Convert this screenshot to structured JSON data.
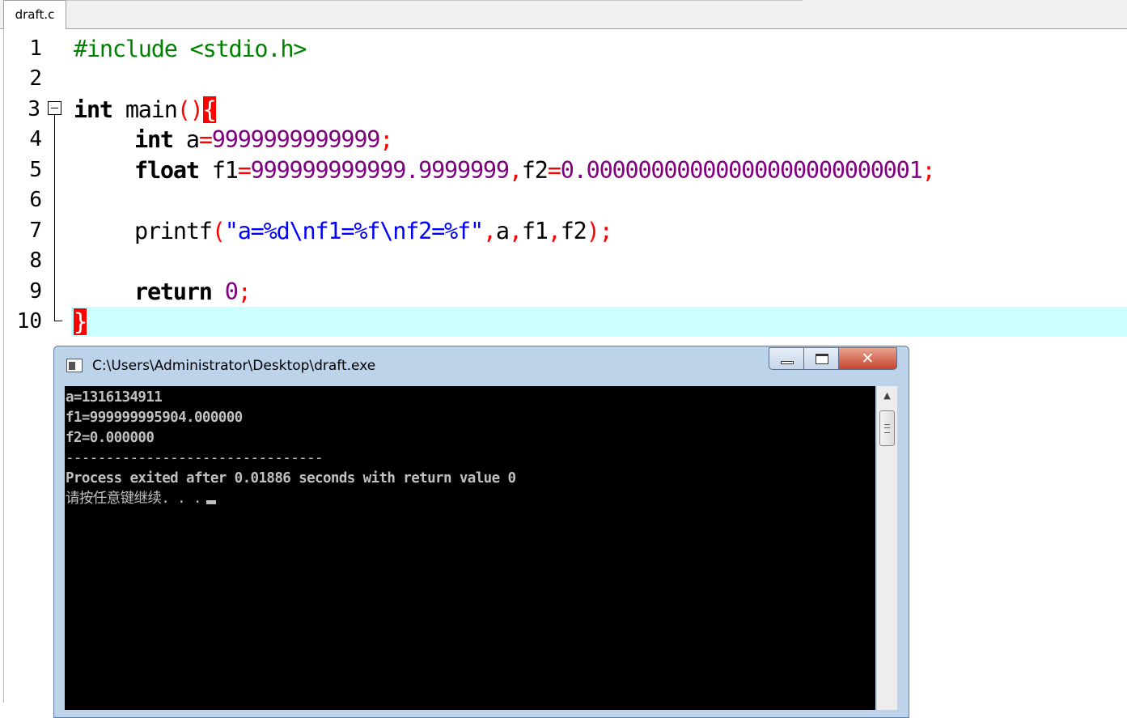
{
  "tab": {
    "label": "draft.c"
  },
  "editor": {
    "line_numbers": [
      "1",
      "2",
      "3",
      "4",
      "5",
      "6",
      "7",
      "8",
      "9",
      "10"
    ],
    "lines": {
      "l1_directive": "#include <stdio.h>",
      "l3_type": "int",
      "l3_func": " main",
      "l3_parens": "()",
      "l3_brace": "{",
      "l4_type": "int",
      "l4_var": " a",
      "l4_eq": "=",
      "l4_val": "9999999999999",
      "l4_semi": ";",
      "l5_type": "float",
      "l5_var1": " f1",
      "l5_eq1": "=",
      "l5_val1": "999999999999.9999999",
      "l5_comma": ",",
      "l5_var2": "f2",
      "l5_eq2": "=",
      "l5_val2": "0.00000000000000000000000001",
      "l5_semi": ";",
      "l7_func": "printf",
      "l7_open": "(",
      "l7_str": "\"a=%d\\nf1=%f\\nf2=%f\"",
      "l7_c1": ",",
      "l7_a": "a",
      "l7_c2": ",",
      "l7_f1": "f1",
      "l7_c3": ",",
      "l7_f2": "f2",
      "l7_close": ");",
      "l9_kw": "return",
      "l9_val": "0",
      "l9_semi": ";",
      "l10_brace": "}"
    }
  },
  "console": {
    "title": "C:\\Users\\Administrator\\Desktop\\draft.exe",
    "output": [
      "a=1316134911",
      "f1=999999995904.000000",
      "f2=0.000000",
      "--------------------------------",
      "Process exited after 0.01886 seconds with return value 0",
      "请按任意键继续. . ."
    ],
    "scroll_up_glyph": "▲",
    "close_glyph": "✕"
  },
  "colors": {
    "preprocessor": "#008000",
    "operator": "#ff0000",
    "number": "#800080",
    "string": "#0000ff",
    "current_line": "#ccffff",
    "console_bg": "#000000",
    "console_text": "#c0c0c0"
  }
}
